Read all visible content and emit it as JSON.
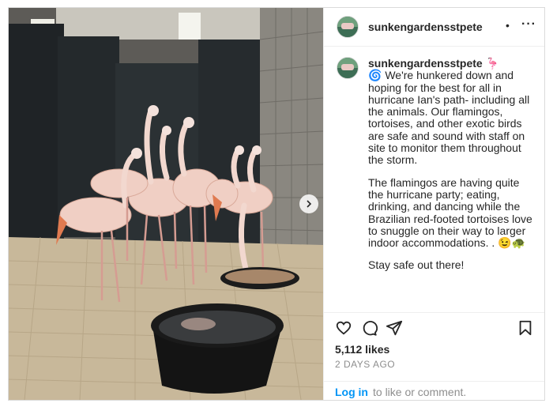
{
  "post": {
    "username": "sunkengardensstpete",
    "header_separator": "•",
    "more_label": "···",
    "caption": {
      "username": "sunkengardensstpete",
      "user_emoji": "🦩",
      "paragraph_1": "🌀 We're hunkered down and hoping for the best for all in hurricane Ian's path- including all the animals. Our flamingos, tortoises, and other exotic birds are safe and sound with staff on site to monitor them throughout the storm.",
      "paragraph_2": "The flamingos are having quite the hurricane party; eating, drinking, and dancing while the Brazilian red-footed tortoises love to snuggle on their way to larger indoor accommodations. . 😉🐢",
      "paragraph_3": "Stay safe out there!"
    },
    "likes": "5,112 likes",
    "timestamp": "2 DAYS AGO",
    "footer": {
      "login_label": "Log in",
      "login_rest": "to like or comment."
    }
  },
  "icons": {
    "like": "heart-icon",
    "comment": "comment-icon",
    "share": "share-icon",
    "save": "bookmark-icon",
    "next": "chevron-right-icon"
  },
  "colors": {
    "link": "#0095f6",
    "text": "#262626",
    "muted": "#8e8e8e",
    "border": "#dbdbdb"
  }
}
